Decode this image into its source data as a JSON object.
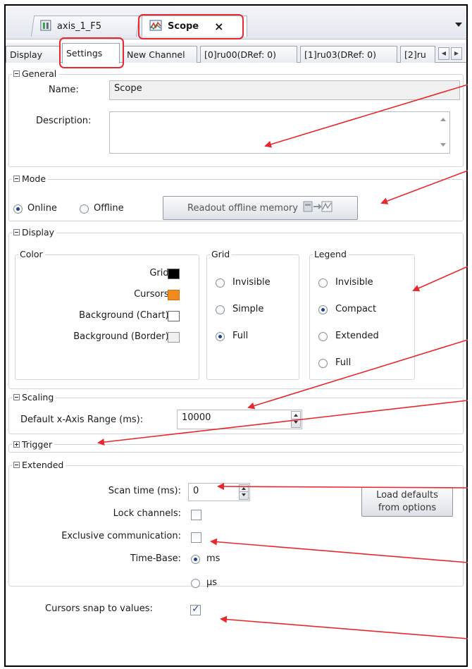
{
  "doc_tabs": [
    {
      "label": "axis_1_F5",
      "icon": "axis-icon"
    },
    {
      "label": "Scope",
      "icon": "scope-icon",
      "active": true,
      "close": "×"
    }
  ],
  "inner_tabs": [
    "Display",
    "Settings",
    "New Channel",
    "[0]ru00(DRef: 0)",
    "[1]ru03(DRef: 0)",
    "[2]ru"
  ],
  "active_inner_tab": "Settings",
  "general": {
    "title": "General",
    "name_label": "Name:",
    "name_value": "Scope",
    "description_label": "Description:",
    "description_value": ""
  },
  "mode": {
    "title": "Mode",
    "online": "Online",
    "offline": "Offline",
    "selected": "Online",
    "readout_button": "Readout offline memory"
  },
  "display": {
    "title": "Display",
    "color": {
      "title": "Color",
      "grid": "Grid:",
      "cursors": "Cursors:",
      "bg_chart": "Background (Chart):",
      "bg_border": "Background (Border):",
      "grid_color": "#000000",
      "cursors_color": "#f28a1e",
      "bg_chart_color": "#ffffff",
      "bg_border_color": "#f0f0f0"
    },
    "grid": {
      "title": "Grid",
      "options": [
        "Invisible",
        "Simple",
        "Full"
      ],
      "selected": "Full"
    },
    "legend": {
      "title": "Legend",
      "options": [
        "Invisible",
        "Compact",
        "Extended",
        "Full"
      ],
      "selected": "Compact"
    }
  },
  "scaling": {
    "title": "Scaling",
    "x_range_label": "Default x-Axis Range (ms):",
    "x_range_value": "10000"
  },
  "trigger": {
    "title": "Trigger"
  },
  "extended": {
    "title": "Extended",
    "scan_time_label": "Scan time (ms):",
    "scan_time_value": "0",
    "load_defaults_line1": "Load defaults",
    "load_defaults_line2": "from options",
    "lock_channels_label": "Lock channels:",
    "lock_channels_checked": false,
    "exclusive_label": "Exclusive communication:",
    "exclusive_checked": false,
    "time_base_label": "Time-Base:",
    "time_base_ms": "ms",
    "time_base_us": "µs",
    "time_base_selected": "ms",
    "snap_label": "Cursors snap to values:",
    "snap_checked": true
  },
  "annotation_color": "#e8282c"
}
